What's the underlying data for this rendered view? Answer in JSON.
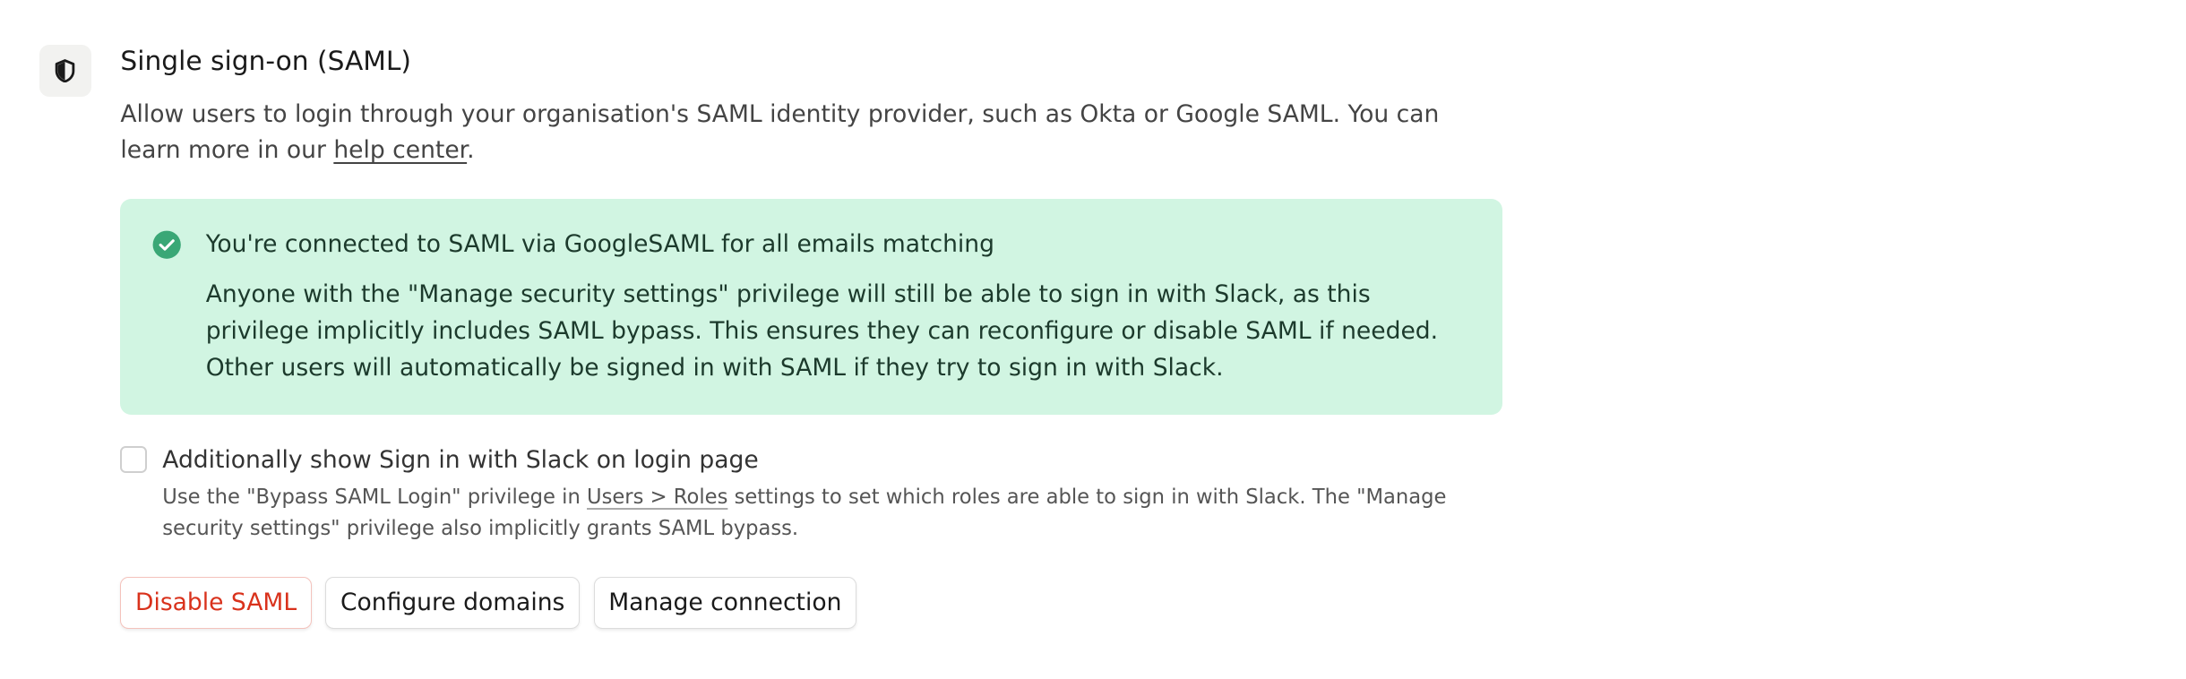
{
  "section": {
    "icon": "half-shield-icon",
    "title": "Single sign-on (SAML)",
    "description": "Allow users to login through your organisation's SAML identity provider, such as Okta or Google SAML. You can learn more in our ",
    "help_link": "help center",
    "description_end": "."
  },
  "callout": {
    "icon": "check-circle-icon",
    "color": "#d1f5e2",
    "accent": "#3aa776",
    "title": "You're connected to SAML via GoogleSAML for all emails matching",
    "body": "Anyone with the \"Manage security settings\" privilege will still be able to sign in with Slack, as this privilege implicitly includes SAML bypass. This ensures they can reconfigure or disable SAML if needed. Other users will automatically be signed in with SAML if they try to sign in with Slack."
  },
  "slack_option": {
    "checked": false,
    "label": "Additionally show Sign in with Slack on login page",
    "help_before": "Use the \"Bypass SAML Login\" privilege in ",
    "help_link": "Users > Roles",
    "help_after": " settings to set which roles are able to sign in with Slack. The \"Manage security settings\" privilege also implicitly grants SAML bypass."
  },
  "actions": {
    "disable": "Disable SAML",
    "configure": "Configure domains",
    "manage": "Manage connection",
    "danger_color": "#d9321c"
  }
}
